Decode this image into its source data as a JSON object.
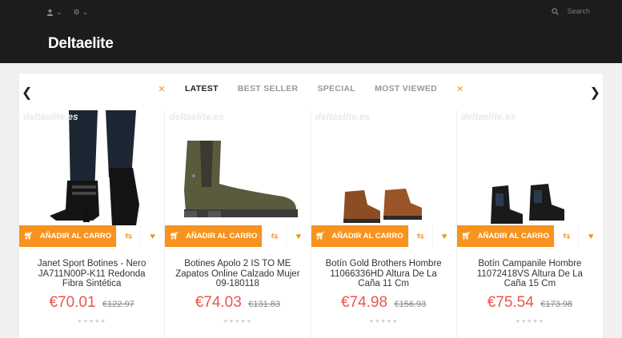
{
  "header": {
    "user_icon": "user-icon",
    "settings_icon": "gear-icon",
    "search_placeholder": "Search",
    "logo": "Deltaelite"
  },
  "tabs": [
    "LATEST",
    "BEST SELLER",
    "SPECIAL",
    "MOST VIEWED"
  ],
  "active_tab": "LATEST",
  "watermark": "deltaelite.es",
  "products": [
    {
      "name": "Janet Sport Botines - Nero JA711N00P-K11 Redonda Fibra Sintética",
      "price": "€70.01",
      "old_price": "€122.97",
      "cart_label": "AÑADIR AL CARRO"
    },
    {
      "name": "Botines Apolo 2 IS TO ME Zapatos Online Calzado Mujer 09-180118",
      "price": "€74.03",
      "old_price": "€131.83",
      "cart_label": "AÑADIR AL CARRO"
    },
    {
      "name": "Botín Gold Brothers Hombre 11066336HD Altura De La Caña 11 Cm",
      "price": "€74.98",
      "old_price": "€156.93",
      "cart_label": "AÑADIR AL CARRO"
    },
    {
      "name": "Botín Campanile Hombre 11072418VS Altura De La Caña 15 Cm",
      "price": "€75.54",
      "old_price": "€173.98",
      "cart_label": "AÑADIR AL CARRO"
    }
  ],
  "colors": {
    "accent": "#f7931e",
    "price": "#e8584f",
    "topbar": "#1c1c1c"
  }
}
